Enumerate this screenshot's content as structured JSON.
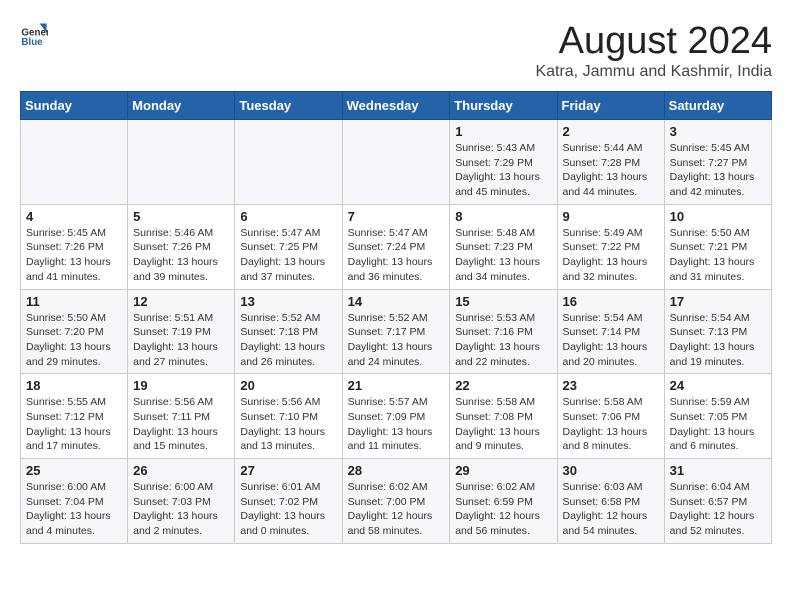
{
  "header": {
    "logo_general": "General",
    "logo_blue": "Blue",
    "month_year": "August 2024",
    "location": "Katra, Jammu and Kashmir, India"
  },
  "days_of_week": [
    "Sunday",
    "Monday",
    "Tuesday",
    "Wednesday",
    "Thursday",
    "Friday",
    "Saturday"
  ],
  "weeks": [
    [
      {
        "day": "",
        "info": ""
      },
      {
        "day": "",
        "info": ""
      },
      {
        "day": "",
        "info": ""
      },
      {
        "day": "",
        "info": ""
      },
      {
        "day": "1",
        "info": "Sunrise: 5:43 AM\nSunset: 7:29 PM\nDaylight: 13 hours and 45 minutes."
      },
      {
        "day": "2",
        "info": "Sunrise: 5:44 AM\nSunset: 7:28 PM\nDaylight: 13 hours and 44 minutes."
      },
      {
        "day": "3",
        "info": "Sunrise: 5:45 AM\nSunset: 7:27 PM\nDaylight: 13 hours and 42 minutes."
      }
    ],
    [
      {
        "day": "4",
        "info": "Sunrise: 5:45 AM\nSunset: 7:26 PM\nDaylight: 13 hours and 41 minutes."
      },
      {
        "day": "5",
        "info": "Sunrise: 5:46 AM\nSunset: 7:26 PM\nDaylight: 13 hours and 39 minutes."
      },
      {
        "day": "6",
        "info": "Sunrise: 5:47 AM\nSunset: 7:25 PM\nDaylight: 13 hours and 37 minutes."
      },
      {
        "day": "7",
        "info": "Sunrise: 5:47 AM\nSunset: 7:24 PM\nDaylight: 13 hours and 36 minutes."
      },
      {
        "day": "8",
        "info": "Sunrise: 5:48 AM\nSunset: 7:23 PM\nDaylight: 13 hours and 34 minutes."
      },
      {
        "day": "9",
        "info": "Sunrise: 5:49 AM\nSunset: 7:22 PM\nDaylight: 13 hours and 32 minutes."
      },
      {
        "day": "10",
        "info": "Sunrise: 5:50 AM\nSunset: 7:21 PM\nDaylight: 13 hours and 31 minutes."
      }
    ],
    [
      {
        "day": "11",
        "info": "Sunrise: 5:50 AM\nSunset: 7:20 PM\nDaylight: 13 hours and 29 minutes."
      },
      {
        "day": "12",
        "info": "Sunrise: 5:51 AM\nSunset: 7:19 PM\nDaylight: 13 hours and 27 minutes."
      },
      {
        "day": "13",
        "info": "Sunrise: 5:52 AM\nSunset: 7:18 PM\nDaylight: 13 hours and 26 minutes."
      },
      {
        "day": "14",
        "info": "Sunrise: 5:52 AM\nSunset: 7:17 PM\nDaylight: 13 hours and 24 minutes."
      },
      {
        "day": "15",
        "info": "Sunrise: 5:53 AM\nSunset: 7:16 PM\nDaylight: 13 hours and 22 minutes."
      },
      {
        "day": "16",
        "info": "Sunrise: 5:54 AM\nSunset: 7:14 PM\nDaylight: 13 hours and 20 minutes."
      },
      {
        "day": "17",
        "info": "Sunrise: 5:54 AM\nSunset: 7:13 PM\nDaylight: 13 hours and 19 minutes."
      }
    ],
    [
      {
        "day": "18",
        "info": "Sunrise: 5:55 AM\nSunset: 7:12 PM\nDaylight: 13 hours and 17 minutes."
      },
      {
        "day": "19",
        "info": "Sunrise: 5:56 AM\nSunset: 7:11 PM\nDaylight: 13 hours and 15 minutes."
      },
      {
        "day": "20",
        "info": "Sunrise: 5:56 AM\nSunset: 7:10 PM\nDaylight: 13 hours and 13 minutes."
      },
      {
        "day": "21",
        "info": "Sunrise: 5:57 AM\nSunset: 7:09 PM\nDaylight: 13 hours and 11 minutes."
      },
      {
        "day": "22",
        "info": "Sunrise: 5:58 AM\nSunset: 7:08 PM\nDaylight: 13 hours and 9 minutes."
      },
      {
        "day": "23",
        "info": "Sunrise: 5:58 AM\nSunset: 7:06 PM\nDaylight: 13 hours and 8 minutes."
      },
      {
        "day": "24",
        "info": "Sunrise: 5:59 AM\nSunset: 7:05 PM\nDaylight: 13 hours and 6 minutes."
      }
    ],
    [
      {
        "day": "25",
        "info": "Sunrise: 6:00 AM\nSunset: 7:04 PM\nDaylight: 13 hours and 4 minutes."
      },
      {
        "day": "26",
        "info": "Sunrise: 6:00 AM\nSunset: 7:03 PM\nDaylight: 13 hours and 2 minutes."
      },
      {
        "day": "27",
        "info": "Sunrise: 6:01 AM\nSunset: 7:02 PM\nDaylight: 13 hours and 0 minutes."
      },
      {
        "day": "28",
        "info": "Sunrise: 6:02 AM\nSunset: 7:00 PM\nDaylight: 12 hours and 58 minutes."
      },
      {
        "day": "29",
        "info": "Sunrise: 6:02 AM\nSunset: 6:59 PM\nDaylight: 12 hours and 56 minutes."
      },
      {
        "day": "30",
        "info": "Sunrise: 6:03 AM\nSunset: 6:58 PM\nDaylight: 12 hours and 54 minutes."
      },
      {
        "day": "31",
        "info": "Sunrise: 6:04 AM\nSunset: 6:57 PM\nDaylight: 12 hours and 52 minutes."
      }
    ]
  ]
}
